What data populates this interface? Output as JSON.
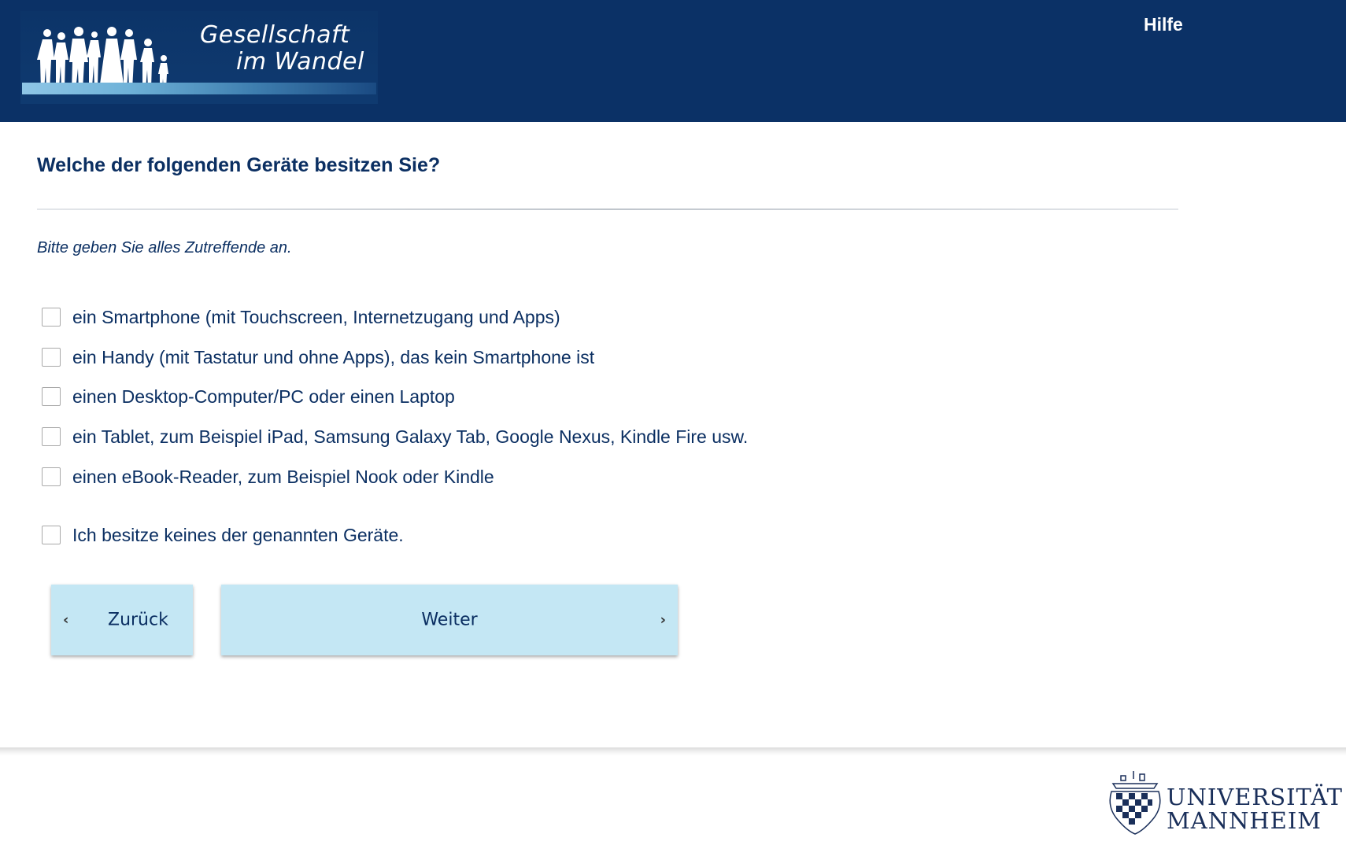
{
  "header": {
    "logo_line1": "Gesellschaft",
    "logo_line2": "im Wandel",
    "help_label": "Hilfe"
  },
  "question": {
    "title": "Welche der folgenden Geräte besitzen Sie?",
    "instruction": "Bitte geben Sie alles Zutreffende an.",
    "options": [
      {
        "label": "ein Smartphone (mit Touchscreen, Internetzugang und Apps)",
        "checked": false
      },
      {
        "label": "ein Handy (mit Tastatur und ohne Apps), das kein Smartphone ist",
        "checked": false
      },
      {
        "label": "einen Desktop-Computer/PC oder einen Laptop",
        "checked": false
      },
      {
        "label": "ein Tablet, zum Beispiel iPad, Samsung Galaxy Tab, Google Nexus, Kindle Fire usw.",
        "checked": false
      },
      {
        "label": "einen eBook-Reader, zum Beispiel Nook oder Kindle",
        "checked": false
      }
    ],
    "exclusive_option": {
      "label": "Ich besitze keines der genannten Geräte.",
      "checked": false
    }
  },
  "navigation": {
    "back_label": "Zurück",
    "next_label": "Weiter",
    "back_icon": "chevron-left-icon",
    "next_icon": "chevron-right-icon"
  },
  "footer": {
    "university_line1": "UNIVERSITÄT",
    "university_line2": "MANNHEIM"
  },
  "colors": {
    "header_bg": "#0b3166",
    "text": "#0b2f62",
    "button_bg": "#c4e7f4"
  }
}
